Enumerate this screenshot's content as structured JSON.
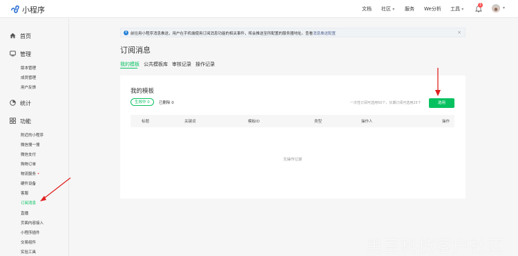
{
  "app": {
    "name": "小程序"
  },
  "topnav": {
    "docs": "文档",
    "community": "社区",
    "service": "服务",
    "analysis": "We分析",
    "tools": "工具",
    "bell_count": "1"
  },
  "sidebar": {
    "home": "首页",
    "manage": {
      "label": "管理",
      "items": [
        "版本管理",
        "成员管理",
        "用户反馈"
      ]
    },
    "stats": "统计",
    "features": {
      "label": "功能",
      "items": [
        "附近的小程序",
        "微信搜一搜",
        "微信支付",
        "购物订单",
        "物流服务",
        "硬件设备",
        "客服",
        "订阅消息",
        "直播",
        "页面内容接入",
        "小程序插件",
        "交易组件",
        "实验工具"
      ]
    }
  },
  "notice": {
    "text": "前往用小程序消息推送，用户在手机端使用订阅消息功能的相关事件，将会推送至所配置的服务器地址。查看",
    "link": "消息推送配置",
    "close": "×"
  },
  "page": {
    "title": "订阅消息",
    "tabs": [
      "我的模板",
      "公共模板库",
      "审核记录",
      "操作记录"
    ]
  },
  "card": {
    "title": "我的模板",
    "in_use": "生效中 0",
    "deleted": "已删除 0",
    "limit": "一次性订阅可选用50个，长期订阅可选用25个",
    "select_button": "选用",
    "columns": [
      "标题",
      "关键词",
      "模板ID",
      "类型",
      "操作人",
      "操作"
    ],
    "empty": "无操作记录"
  },
  "watermark": "黑豆科技客户社区",
  "colors": {
    "accent": "#07c160",
    "annotation": "#e02020",
    "badge": "#fa5151"
  }
}
